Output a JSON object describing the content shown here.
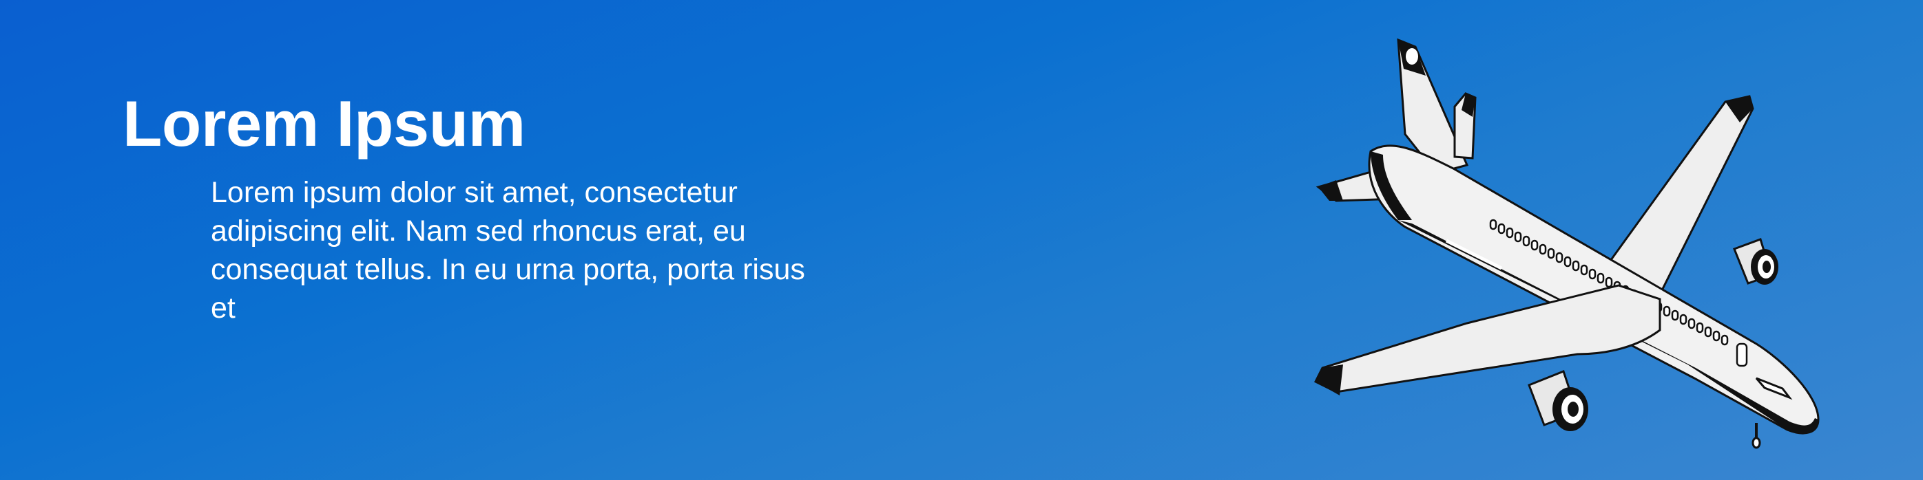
{
  "banner": {
    "title": "Lorem Ipsum",
    "body": "Lorem ipsum dolor sit amet, consectetur adipiscing elit. Nam sed rhoncus erat, eu consequat tellus. In eu urna porta, porta risus et"
  },
  "illustration": {
    "icon": "airplane-icon"
  },
  "colors": {
    "background_start": "#0a5fd0",
    "background_end": "#3a86d0",
    "text": "#ffffff",
    "plane_body": "#f2f2f2",
    "plane_dark": "#111111"
  }
}
